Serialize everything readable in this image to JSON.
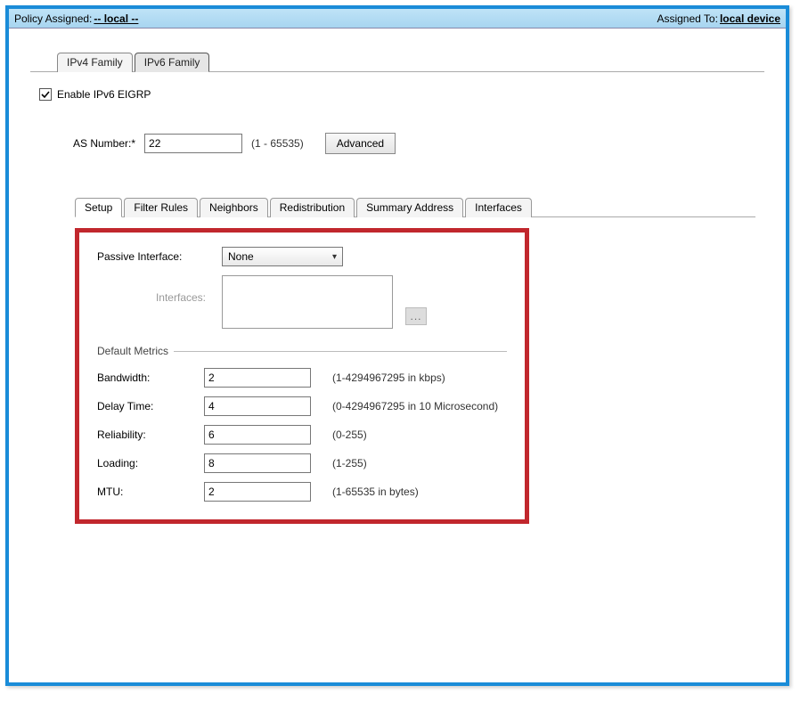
{
  "header": {
    "policy_label": "Policy Assigned: ",
    "policy_value": "-- local --",
    "assigned_label": "Assigned To: ",
    "assigned_value": "local device"
  },
  "family_tabs": {
    "ipv4": "IPv4 Family",
    "ipv6": "IPv6 Family"
  },
  "enable_checkbox_label": "Enable IPv6 EIGRP",
  "as": {
    "label": "AS Number:",
    "required": "*",
    "value": "22",
    "hint": "(1 - 65535)",
    "advanced_btn": "Advanced"
  },
  "sub_tabs": {
    "setup": "Setup",
    "filter": "Filter Rules",
    "neighbors": "Neighbors",
    "redistribution": "Redistribution",
    "summary": "Summary Address",
    "interfaces": "Interfaces"
  },
  "setup": {
    "passive_label": "Passive Interface:",
    "passive_value": "None",
    "interfaces_label": "Interfaces:",
    "browse": "...",
    "default_metrics_label": "Default Metrics",
    "metrics": {
      "bandwidth": {
        "label": "Bandwidth:",
        "value": "2",
        "hint": "(1-4294967295 in kbps)"
      },
      "delay": {
        "label": "Delay Time:",
        "value": "4",
        "hint": "(0-4294967295 in 10 Microsecond)"
      },
      "reliability": {
        "label": "Reliability:",
        "value": "6",
        "hint": "(0-255)"
      },
      "loading": {
        "label": "Loading:",
        "value": "8",
        "hint": "(1-255)"
      },
      "mtu": {
        "label": "MTU:",
        "value": "2",
        "hint": "(1-65535 in bytes)"
      }
    }
  }
}
